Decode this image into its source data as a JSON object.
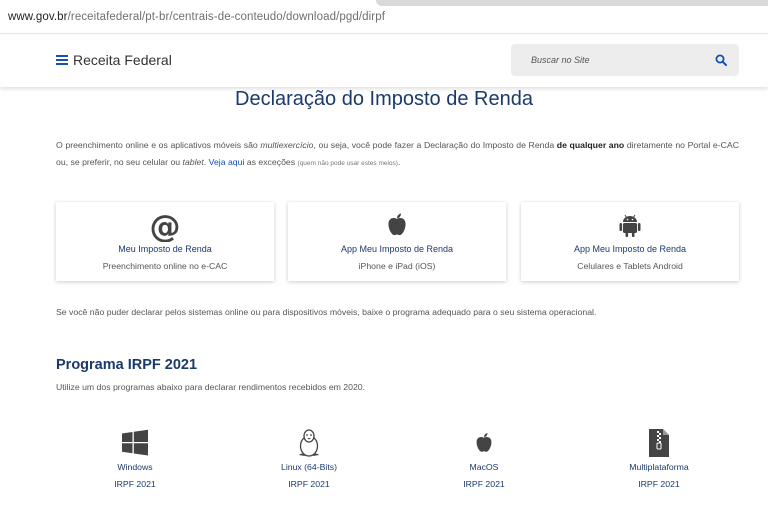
{
  "browser": {
    "url_host": "www.gov.br",
    "url_path": "/receitafederal/pt-br/centrais-de-conteudo/download/pgd/dirpf"
  },
  "header": {
    "site_title": "Receita Federal",
    "search_placeholder": "Buscar no Site"
  },
  "main": {
    "title": "Declaração do Imposto de Renda",
    "intro": {
      "part1": "O preenchimento online e os aplicativos móveis são ",
      "multi": "multiexercício",
      "part2": ", ou seja, você pode fazer a Declaração do Imposto de Renda ",
      "strong": "de qualquer ano",
      "part3": " diretamente no Portal e-CAC ou, se preferir, no seu celular ou ",
      "tablet": "tablet",
      "part4": ". ",
      "link": "Veja aqui",
      "part5": " as exceções ",
      "small": "(quem não pode usar estes meios)",
      "part6": "."
    },
    "cards": [
      {
        "icon": "at-icon",
        "title": "Meu Imposto de Renda",
        "subtitle": "Preenchimento online no e-CAC"
      },
      {
        "icon": "apple-icon",
        "title": "App Meu Imposto de Renda",
        "subtitle": "iPhone e iPad (iOS)"
      },
      {
        "icon": "android-icon",
        "title": "App Meu Imposto de Renda",
        "subtitle": "Celulares e Tablets Android"
      }
    ],
    "note": "Se você não puder declarar pelos sistemas online ou para dispositivos móveis, baixe o programa adequado para o seu sistema operacional.",
    "program_section": {
      "title": "Programa IRPF 2021",
      "subtitle": "Utilize um dos programas abaixo para declarar rendimentos recebidos em 2020.",
      "programs": [
        {
          "icon": "windows-icon",
          "label": "Windows",
          "version": "IRPF 2021"
        },
        {
          "icon": "linux-icon",
          "label": "Linux (64-Bits)",
          "version": "IRPF 2021"
        },
        {
          "icon": "apple-icon",
          "label": "MacOS",
          "version": "IRPF 2021"
        },
        {
          "icon": "zip-file-icon",
          "label": "Multiplataforma",
          "version": "IRPF 2021"
        }
      ]
    }
  },
  "colors": {
    "brand_blue": "#1351b4",
    "title_navy": "#1b3a6b",
    "text_gray": "#555555",
    "search_bg": "#ededed"
  }
}
